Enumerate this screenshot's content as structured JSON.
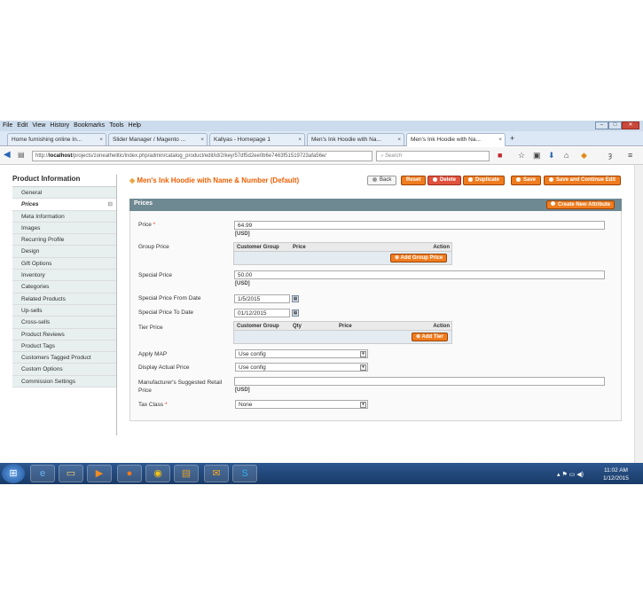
{
  "browser": {
    "menu": [
      "File",
      "Edit",
      "View",
      "History",
      "Bookmarks",
      "Tools",
      "Help"
    ],
    "tabs": [
      {
        "label": "Home furnishing online In..."
      },
      {
        "label": "Slider Manager / Magento ..."
      },
      {
        "label": "Kallyas - Homepage 1"
      },
      {
        "label": "Men's Ink Hoodie with Na..."
      },
      {
        "label": "Men's Ink Hoodie with Na..."
      }
    ],
    "new_tab": "+",
    "url_prefix": "http://",
    "url_host": "localhost",
    "url_path": "/projects/zoneathelitic/index.php/admin/catalog_product/edit/id/2/key/57df5d2ee0b6e7463f51519723afa56e/",
    "search_placeholder": "Search"
  },
  "sidebar": {
    "title": "Product Information",
    "items": [
      "General",
      "Prices",
      "Meta Information",
      "Images",
      "Recurring Profile",
      "Design",
      "Gift Options",
      "Inventory",
      "Categories",
      "Related Products",
      "Up-sells",
      "Cross-sells",
      "Product Reviews",
      "Product Tags",
      "Customers Tagged Product",
      "Custom Options",
      "Commission Settings"
    ],
    "toggle": "⊟"
  },
  "header": {
    "title": "Men's Ink Hoodie with Name & Number (Default)",
    "buttons": {
      "back": "Back",
      "reset": "Reset",
      "delete": "Delete",
      "duplicate": "Duplicate",
      "save": "Save",
      "save_continue": "Save and Continue Edit"
    }
  },
  "prices": {
    "section_title": "Prices",
    "create_attr": "Create New Attribute",
    "price_label": "Price",
    "req_mark": "*",
    "price_value": "64.99",
    "currency": "[USD]",
    "group_price_label": "Group Price",
    "group_cols": [
      "Customer Group",
      "Price",
      "Action"
    ],
    "add_group_price": "Add Group Price",
    "special_price_label": "Special Price",
    "special_price_value": "50.00",
    "special_from_label": "Special Price From Date",
    "special_from_value": "1/5/2015",
    "special_to_label": "Special Price To Date",
    "special_to_value": "01/12/2015",
    "tier_label": "Tier Price",
    "tier_cols": [
      "Customer Group",
      "Qty",
      "Price",
      "Action"
    ],
    "add_tier": "Add Tier",
    "apply_map_label": "Apply MAP",
    "apply_map_value": "Use config",
    "display_actual_label": "Display Actual Price",
    "display_actual_value": "Use config",
    "msrp_label": "Manufacturer's Suggested Retail Price",
    "tax_label": "Tax Class",
    "tax_value": "None"
  },
  "taskbar": {
    "time": "11:02 AM",
    "date": "1/12/2015"
  }
}
